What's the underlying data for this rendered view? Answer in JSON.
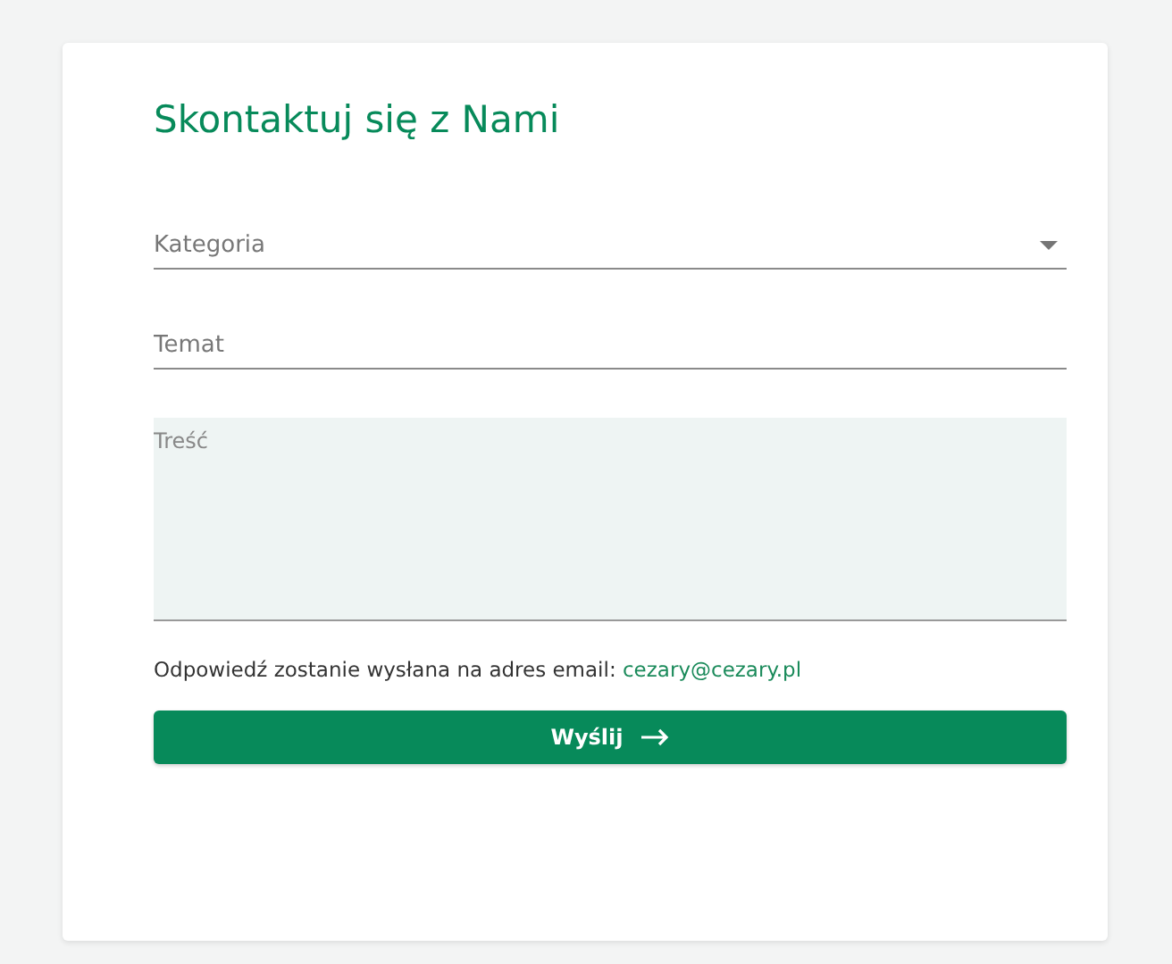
{
  "title": "Skontaktuj się z Nami",
  "fields": [
    {
      "kind": "select",
      "placeholder": "Kategoria"
    },
    {
      "kind": "text",
      "placeholder": "Temat"
    },
    {
      "kind": "textarea",
      "placeholder": "Treść"
    }
  ],
  "note": {
    "text": "Odpowiedź zostanie wysłana na adres email:",
    "email": "cezary@cezary.pl"
  },
  "submit": {
    "label": "Wyślij"
  }
}
